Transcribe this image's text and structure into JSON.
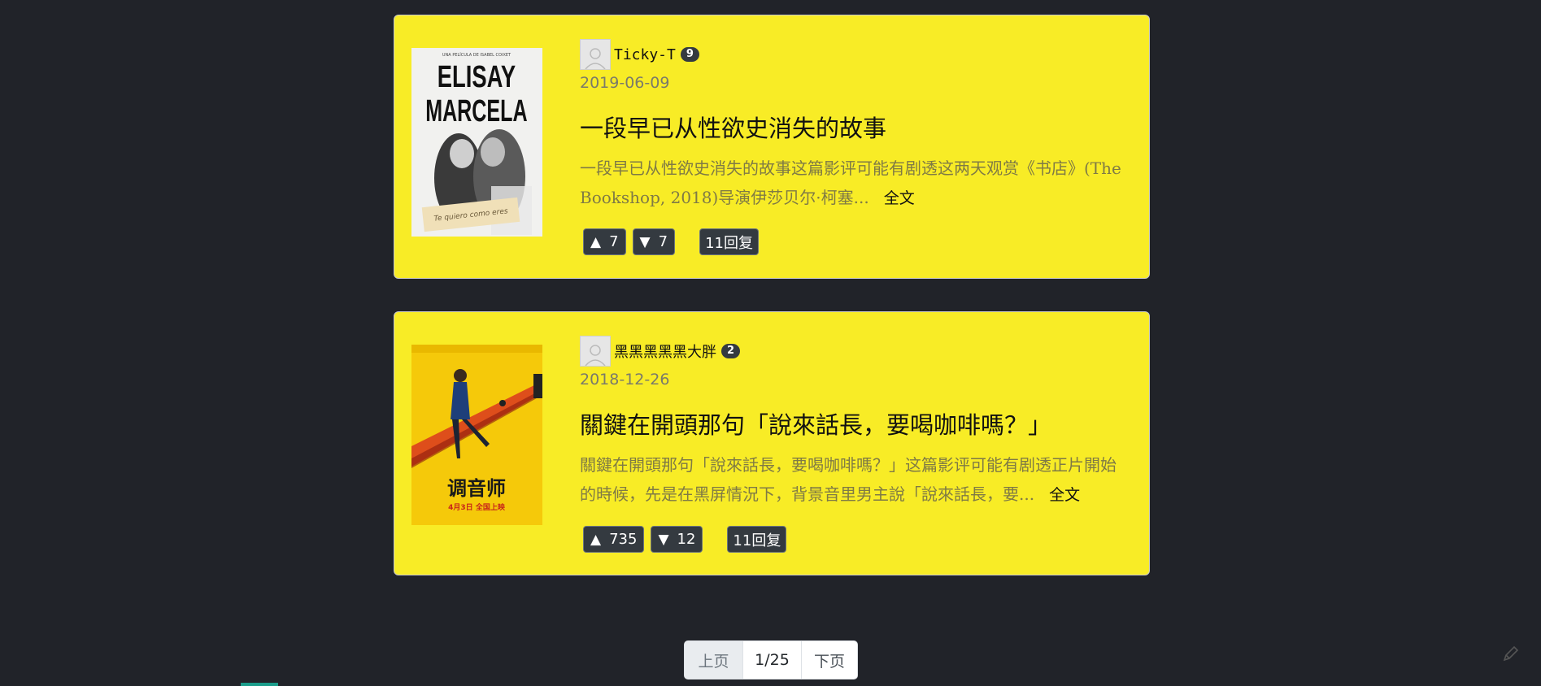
{
  "reviews": [
    {
      "user": "Ticky-T",
      "badge": "9",
      "date": "2019-06-09",
      "title": "一段早已从性欲史消失的故事",
      "excerpt": "一段早已从性欲史消失的故事这篇影评可能有剧透这两天观赏《书店》(The Bookshop, 2018)导演伊莎贝尔·柯塞...",
      "more": "全文",
      "up": "7",
      "down": "7",
      "replies": "11回复",
      "poster": {
        "top_text": "UNA PELÍCULA DE ISABEL COIXET",
        "line1": "ELISAY",
        "line2": "MARCELA",
        "caption": "Te quiero como eres"
      }
    },
    {
      "user": "黑黑黑黑黑大胖",
      "badge": "2",
      "date": "2018-12-26",
      "title": "關鍵在開頭那句「說來話長，要喝咖啡嗎？」",
      "excerpt": "關鍵在開頭那句「說來話長，要喝咖啡嗎？」这篇影评可能有剧透正片開始的時候，先是在黑屏情況下，背景音里男主說「說來話長，要...",
      "more": "全文",
      "up": "735",
      "down": "12",
      "replies": "11回复",
      "poster": {
        "big": "调音师",
        "date": "4月3日 全国上映"
      }
    }
  ],
  "pagination": {
    "prev": "上页",
    "current": "1/25",
    "next": "下页"
  },
  "colors": {
    "card": "#f8ec26",
    "background": "#212329",
    "button": "#343a40"
  },
  "icons": {
    "up": "triangle-up",
    "down": "triangle-down",
    "fab": "pencil-icon"
  }
}
